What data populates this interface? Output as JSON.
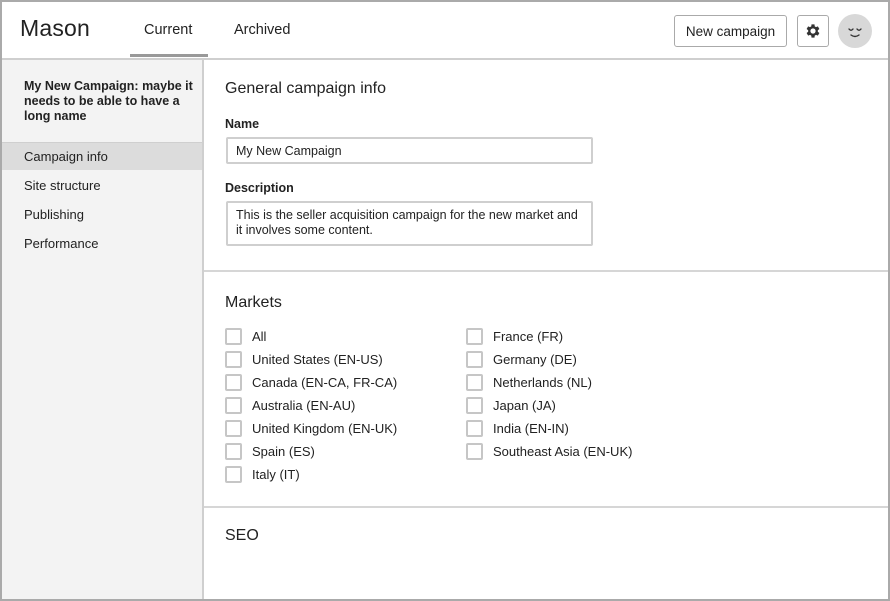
{
  "app": {
    "title": "Mason"
  },
  "header": {
    "tabs": [
      {
        "label": "Current"
      },
      {
        "label": "Archived"
      }
    ],
    "new_campaign_label": "New campaign"
  },
  "icons": {
    "settings": "gear-icon",
    "avatar": "smiley-face-icon"
  },
  "sidebar": {
    "campaign_name": "My New Campaign: maybe it needs to be able to have a long name",
    "items": [
      {
        "label": "Campaign info"
      },
      {
        "label": "Site structure"
      },
      {
        "label": "Publishing"
      },
      {
        "label": "Performance"
      }
    ]
  },
  "general": {
    "title": "General campaign info",
    "name_label": "Name",
    "name_value": "My New Campaign",
    "description_label": "Description",
    "description_value": "This is the seller acquisition campaign for the new market and it involves some content."
  },
  "markets": {
    "title": "Markets",
    "left": [
      {
        "label": "All"
      },
      {
        "label": "United States (EN-US)"
      },
      {
        "label": "Canada (EN-CA, FR-CA)"
      },
      {
        "label": "Australia (EN-AU)"
      },
      {
        "label": "United Kingdom (EN-UK)"
      },
      {
        "label": "Spain (ES)"
      },
      {
        "label": "Italy (IT)"
      }
    ],
    "right": [
      {
        "label": "France (FR)"
      },
      {
        "label": "Germany (DE)"
      },
      {
        "label": "Netherlands (NL)"
      },
      {
        "label": "Japan (JA)"
      },
      {
        "label": "India (EN-IN)"
      },
      {
        "label": "Southeast Asia (EN-UK)"
      }
    ]
  },
  "seo": {
    "title": "SEO"
  }
}
